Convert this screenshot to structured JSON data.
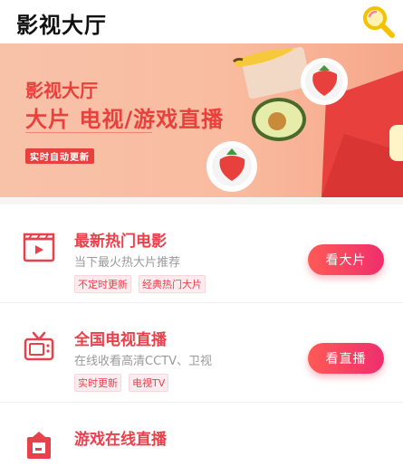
{
  "header": {
    "title": "影视大厅",
    "search_icon": "search-icon"
  },
  "banner": {
    "title": "影视大厅",
    "subtitle": "大片 电视/游戏直播",
    "badge": "实时自动更新"
  },
  "cards": [
    {
      "title": "最新热门电影",
      "desc": "当下最火热大片推荐",
      "tags": [
        "不定时更新",
        "经典热门大片"
      ],
      "action": "看大片",
      "icon": "film-icon"
    },
    {
      "title": "全国电视直播",
      "desc": "在线收看高清CCTV、卫视",
      "tags": [
        "实时更新",
        "电视TV"
      ],
      "action": "看直播",
      "icon": "tv-icon"
    },
    {
      "title": "游戏在线直播",
      "icon": "game-icon"
    }
  ],
  "colors": {
    "accent": "#e8414c",
    "button_start": "#ff5a55",
    "button_end": "#ef2e6e",
    "banner_bg": "#f8c2a9"
  }
}
